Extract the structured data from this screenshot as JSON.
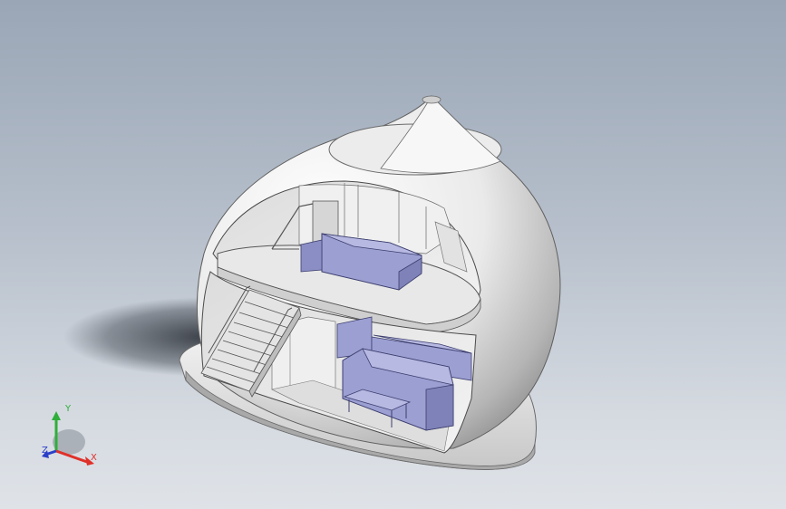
{
  "viewport": {
    "background_top": "#9aa6b6",
    "background_bottom": "#dfe3e8"
  },
  "model": {
    "shell_color": "#f2f2f2",
    "shell_shade": "#8c8c8c",
    "interior_color": "#e6e6e6",
    "furniture_color": "#9c9fd2",
    "furniture_edge": "#3c3e6e"
  },
  "triad": {
    "x_label": "X",
    "y_label": "Y",
    "z_label": "Z",
    "x_color": "#e0302a",
    "y_color": "#2fae3a",
    "z_color": "#2a3fc8"
  }
}
